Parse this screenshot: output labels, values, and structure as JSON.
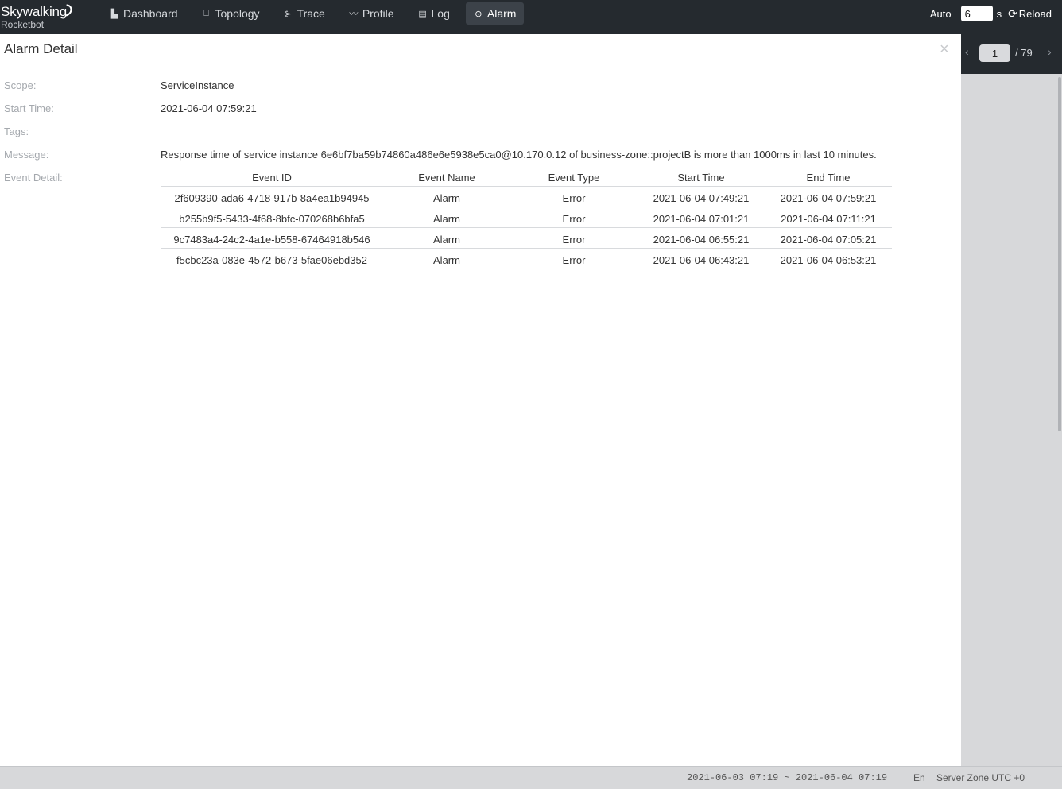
{
  "app": {
    "logo_main": "Skywalking",
    "logo_sub": "Rocketbot"
  },
  "nav": [
    {
      "label": "Dashboard",
      "icon": "chart-bar-icon",
      "glyph": "▙"
    },
    {
      "label": "Topology",
      "icon": "topology-icon",
      "glyph": "⎕"
    },
    {
      "label": "Trace",
      "icon": "trace-icon",
      "glyph": "⊱"
    },
    {
      "label": "Profile",
      "icon": "profile-icon",
      "glyph": "〰"
    },
    {
      "label": "Log",
      "icon": "log-icon",
      "glyph": "▤"
    },
    {
      "label": "Alarm",
      "icon": "alarm-icon",
      "glyph": "⊙",
      "active": true
    }
  ],
  "auto": {
    "label": "Auto",
    "value": "6",
    "unit": "s",
    "reload_label": "Reload"
  },
  "detail": {
    "title": "Alarm Detail",
    "close": "×",
    "scope_label": "Scope:",
    "scope": "ServiceInstance",
    "start_label": "Start Time:",
    "start_time": "2021-06-04 07:59:21",
    "tags_label": "Tags:",
    "tags": "",
    "message_label": "Message:",
    "message": "Response time of service instance 6e6bf7ba59b74860a486e6e5938e5ca0@10.170.0.12 of business-zone::projectB is more than 1000ms in last 10 minutes.",
    "event_label": "Event Detail:"
  },
  "events": {
    "headers": [
      "Event ID",
      "Event Name",
      "Event Type",
      "Start Time",
      "End Time"
    ],
    "rows": [
      [
        "2f609390-ada6-4718-917b-8a4ea1b94945",
        "Alarm",
        "Error",
        "2021-06-04 07:49:21",
        "2021-06-04 07:59:21"
      ],
      [
        "b255b9f5-5433-4f68-8bfc-070268b6bfa5",
        "Alarm",
        "Error",
        "2021-06-04 07:01:21",
        "2021-06-04 07:11:21"
      ],
      [
        "9c7483a4-24c2-4a1e-b558-67464918b546",
        "Alarm",
        "Error",
        "2021-06-04 06:55:21",
        "2021-06-04 07:05:21"
      ],
      [
        "f5cbc23a-083e-4572-b673-5fae06ebd352",
        "Alarm",
        "Error",
        "2021-06-04 06:43:21",
        "2021-06-04 06:53:21"
      ]
    ]
  },
  "pager": {
    "current": "1",
    "total": "/ 79"
  },
  "footer": {
    "range": "2021-06-03 07:19 ~ 2021-06-04 07:19",
    "lang": "En",
    "zone": "Server Zone UTC +0"
  }
}
